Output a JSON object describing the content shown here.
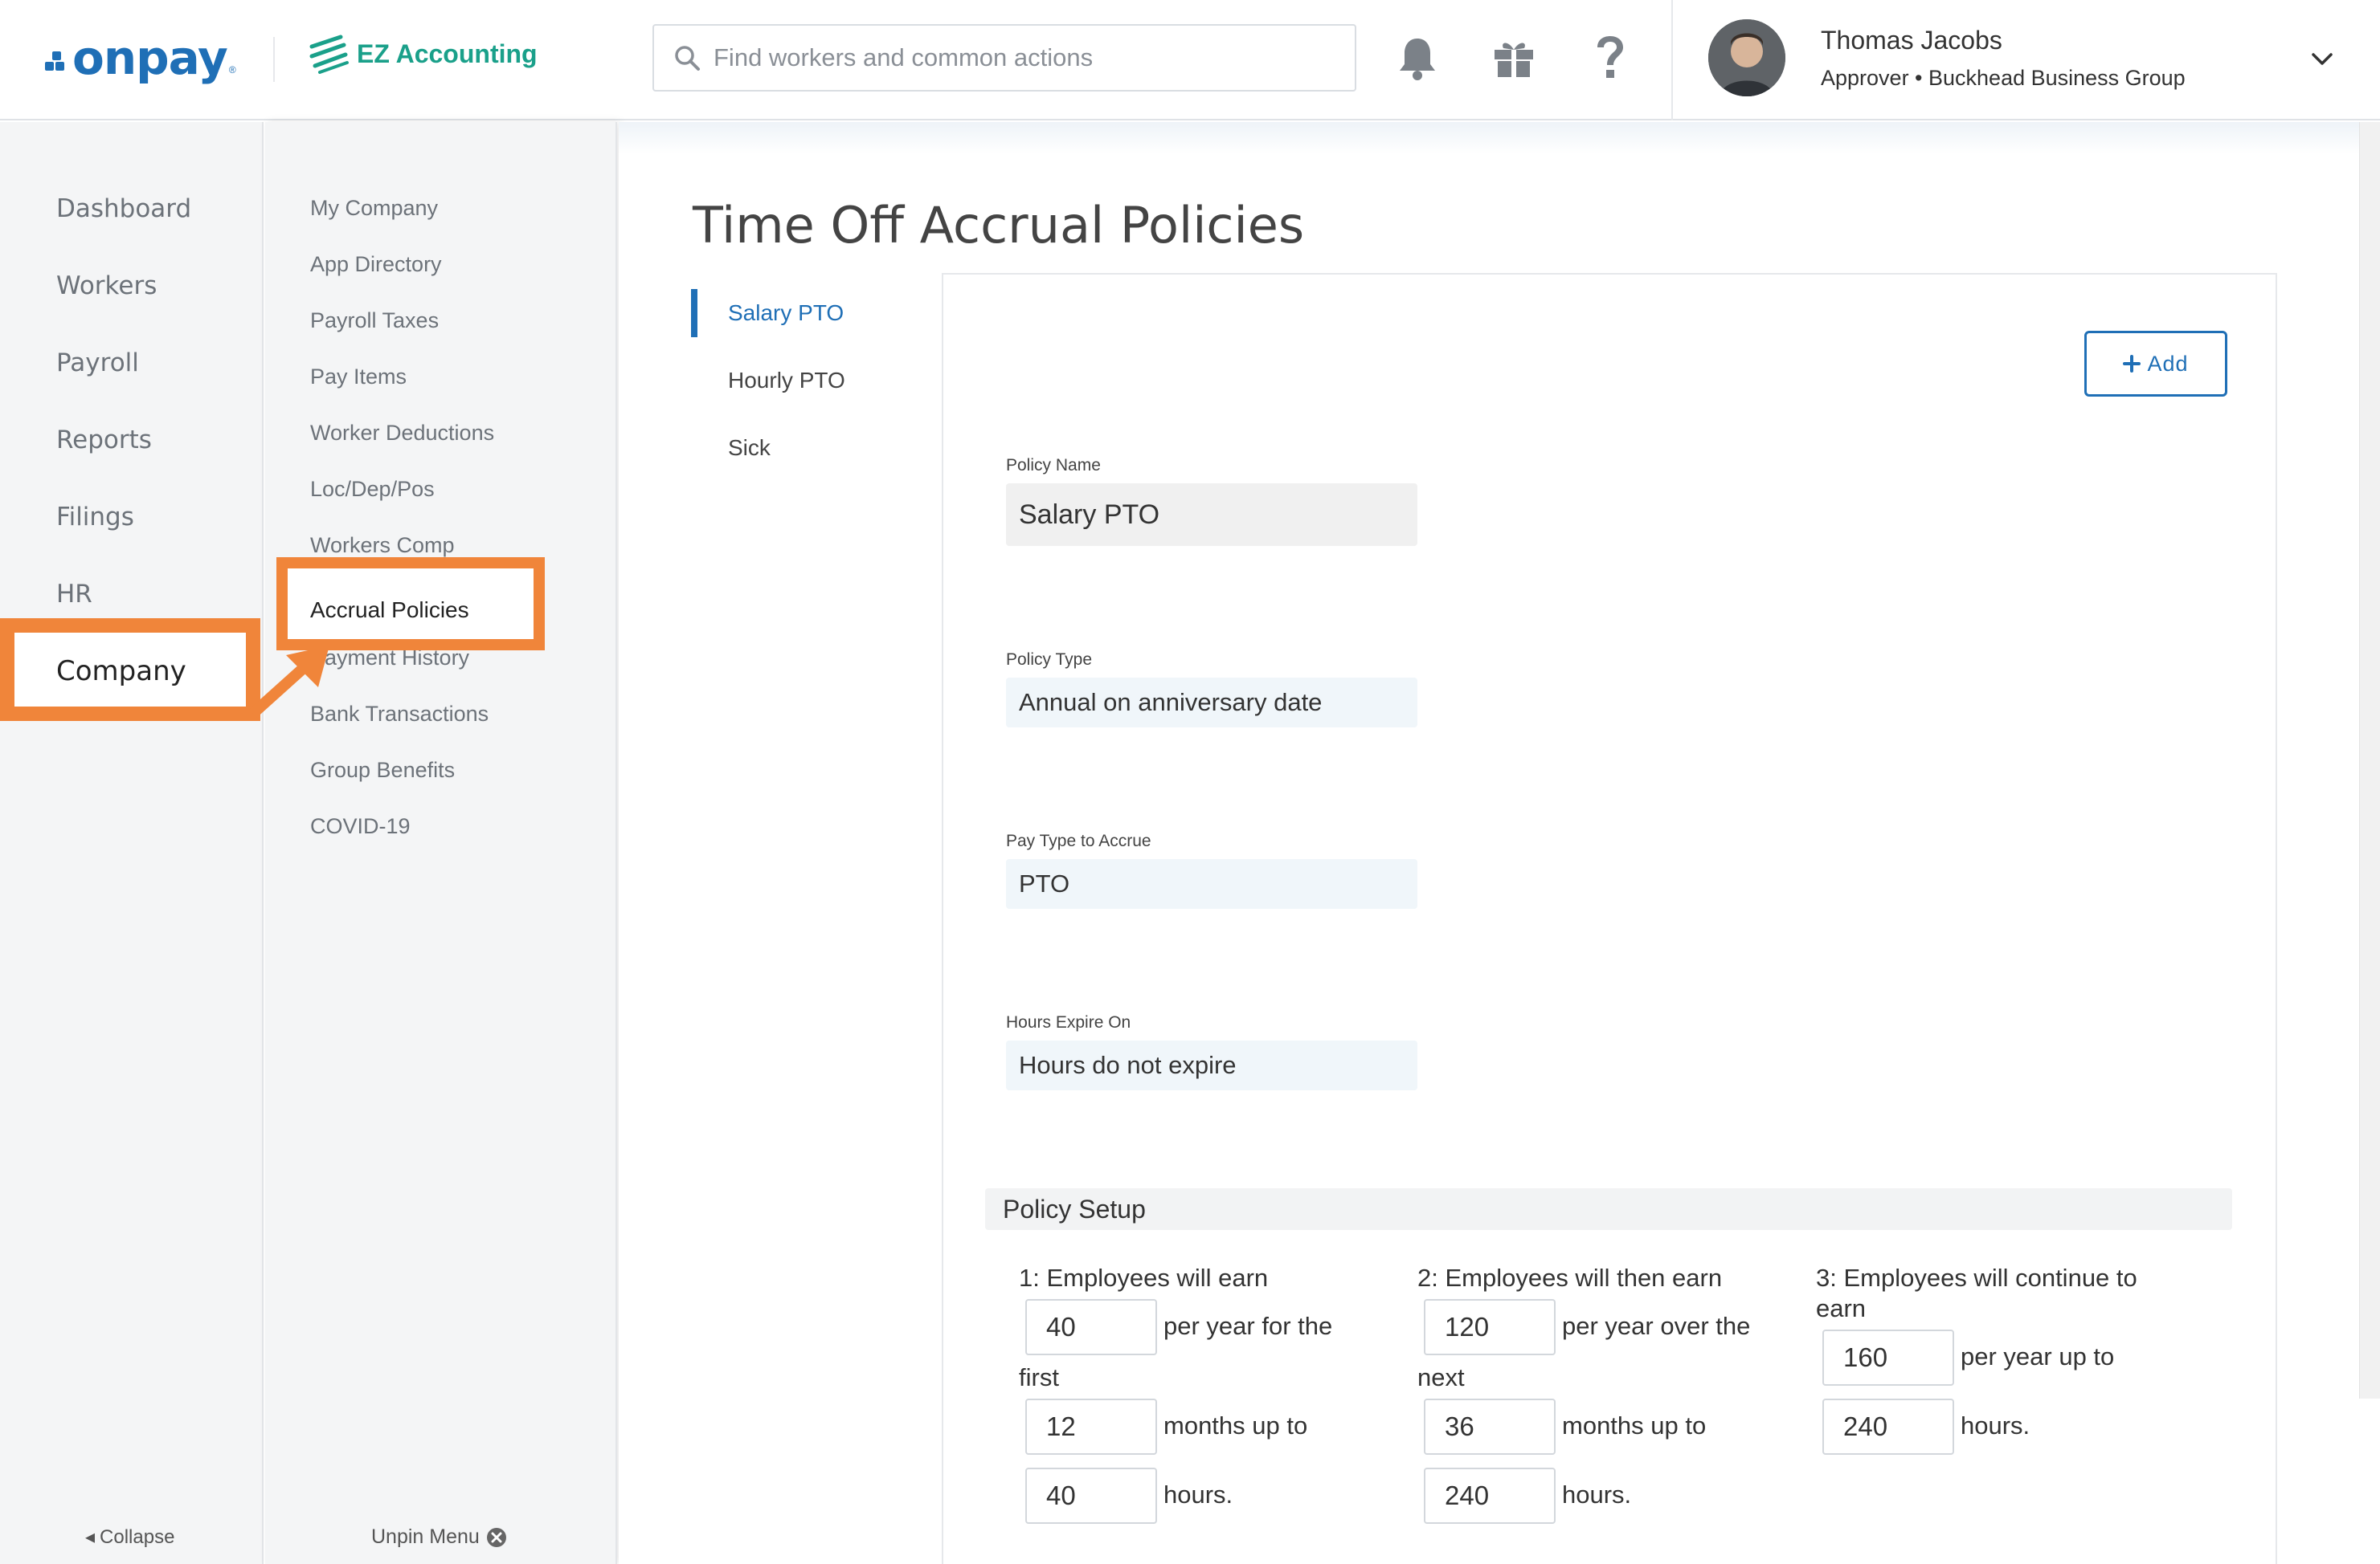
{
  "header": {
    "brand": "onpay",
    "partner": "EZ Accounting",
    "search_placeholder": "Find workers and common actions",
    "icons": [
      "bell-icon",
      "gift-icon",
      "help-icon"
    ],
    "user": {
      "name": "Thomas Jacobs",
      "role": "Approver • Buckhead Business Group"
    }
  },
  "nav": {
    "items": [
      "Dashboard",
      "Workers",
      "Payroll",
      "Reports",
      "Filings",
      "HR",
      "Company"
    ],
    "collapse_label": "Collapse"
  },
  "subnav": {
    "items": [
      "My Company",
      "App Directory",
      "Payroll Taxes",
      "Pay Items",
      "Worker Deductions",
      "Loc/Dep/Pos",
      "Workers Comp",
      "Accrual Policies",
      "Payment History",
      "Bank Transactions",
      "Group Benefits",
      "COVID-19"
    ],
    "unpin_label": "Unpin Menu"
  },
  "page": {
    "title": "Time Off Accrual Policies",
    "tabs": [
      "Salary PTO",
      "Hourly PTO",
      "Sick"
    ],
    "add_label": "Add"
  },
  "policy": {
    "name_label": "Policy Name",
    "name_value": "Salary PTO",
    "type_label": "Policy Type",
    "type_value": "Annual on anniversary date",
    "paytype_label": "Pay Type to Accrue",
    "paytype_value": "PTO",
    "expire_label": "Hours Expire On",
    "expire_value": "Hours do not expire"
  },
  "setup": {
    "title": "Policy Setup",
    "step1": {
      "heading": "1: Employees will earn",
      "t1": "per year for the",
      "t2": "first",
      "t3": "months up to",
      "t4": "hours.",
      "v1": "40",
      "v2": "12",
      "v3": "40"
    },
    "step2": {
      "heading": "2: Employees will then earn",
      "t1": "per year over the",
      "t2": "next",
      "t3": "months up to",
      "t4": "hours.",
      "v1": "120",
      "v2": "36",
      "v3": "240"
    },
    "step3": {
      "heading1": "3: Employees will continue to",
      "heading2": "earn",
      "t1": "per year up to",
      "t2": "hours.",
      "v1": "160",
      "v2": "240"
    }
  },
  "colors": {
    "brand_blue": "#1f6fb6",
    "partner_green": "#1aa08a",
    "highlight_orange": "#f0853a"
  }
}
